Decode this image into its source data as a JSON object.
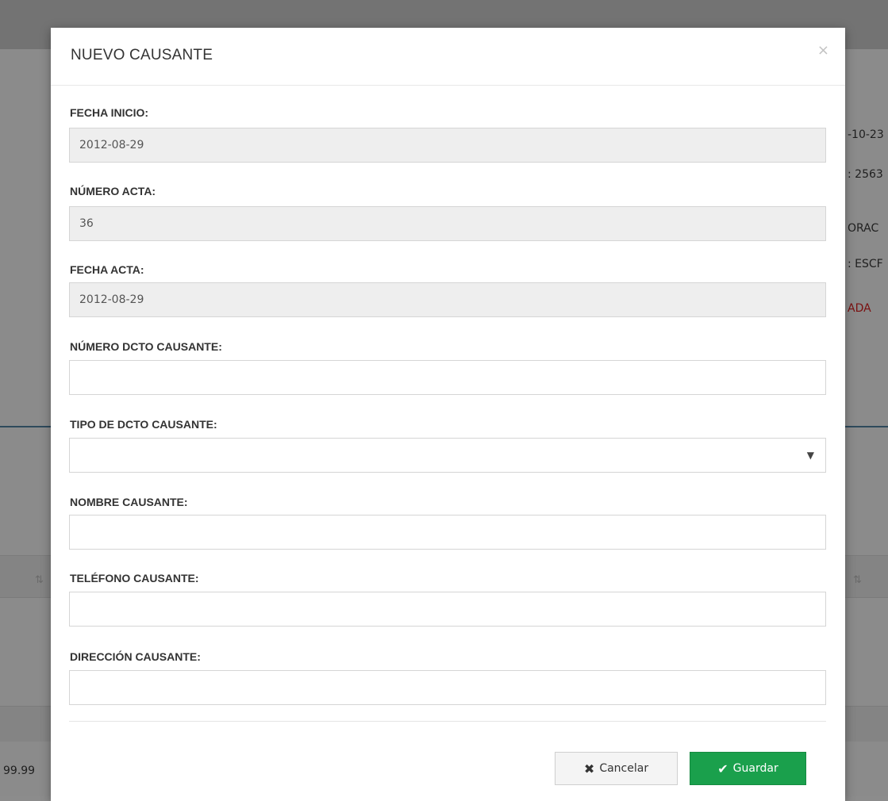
{
  "background": {
    "right_texts": [
      "-10-23",
      ": 2563",
      "ORAC",
      ": ESCF",
      "ADA"
    ],
    "bottom_left_text": "99.99",
    "sort_glyph": "⇅"
  },
  "modal": {
    "title": "NUEVO CAUSANTE",
    "close_label": "×",
    "fields": [
      {
        "label": "FECHA INICIO:",
        "value": "2012-08-29",
        "readonly": true
      },
      {
        "label": "NÚMERO ACTA:",
        "value": "36",
        "readonly": true
      },
      {
        "label": "FECHA ACTA:",
        "value": "2012-08-29",
        "readonly": true
      },
      {
        "label": "NÚMERO DCTO CAUSANTE:",
        "value": "",
        "readonly": false
      },
      {
        "label": "TIPO DE DCTO CAUSANTE:",
        "value": "",
        "type": "select"
      },
      {
        "label": "NOMBRE CAUSANTE:",
        "value": "",
        "readonly": false
      },
      {
        "label": "TELÉFONO CAUSANTE:",
        "value": "",
        "readonly": false
      },
      {
        "label": "DIRECCIÓN CAUSANTE:",
        "value": "",
        "readonly": false
      }
    ],
    "select_arrow": "▼",
    "buttons": {
      "cancel_icon": "✖",
      "cancel_label": "Cancelar",
      "save_icon": "✔",
      "save_label": "Guardar"
    }
  },
  "colors": {
    "save_button": "#1aa04c",
    "readonly_field": "#eeeeee",
    "overlay": "#8b8b8b"
  }
}
